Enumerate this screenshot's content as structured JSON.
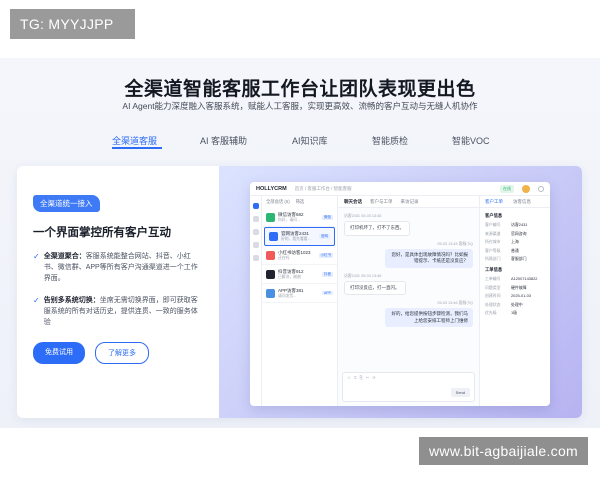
{
  "overlay": {
    "tag_label": "TG: MYYJJPP",
    "watermark": "www.bit-agbaijiale.com"
  },
  "hero": {
    "title": "全渠道智能客服工作台让团队表现更出色",
    "subtitle": "AI Agent能力深度融入客服系统，赋能人工客服，实现更高效、流畅的客户互动与无缝人机协作"
  },
  "tabs": [
    {
      "label": "全渠道客服",
      "active": true
    },
    {
      "label": "AI 客服辅助",
      "active": false
    },
    {
      "label": "AI知识库",
      "active": false
    },
    {
      "label": "智能质检",
      "active": false
    },
    {
      "label": "智能VOC",
      "active": false
    }
  ],
  "feature": {
    "badge": "全渠道统一接入",
    "title": "一个界面掌控所有客户互动",
    "bullets": [
      {
        "head": "全渠道聚合：",
        "text": "客服系统能整合网站、抖音、小红书、微信群、APP等所有客户沟通渠道进一个工作界面。"
      },
      {
        "head": "告别多系统切换：",
        "text": "坐席无需切换界面，即可获取客服系统的所有对话历史，提供连贯、一致的服务体验"
      }
    ],
    "primary_button": "免费试用",
    "secondary_button": "了解更多"
  },
  "mock_app": {
    "brand": "HOLLYCRM",
    "breadcrumb": "首页 / 客服工作台 / 智能客服",
    "status": "在线",
    "conv_header": [
      "全部会话 (6)",
      "筛选"
    ],
    "conversations": [
      {
        "name": "微信访客682",
        "sub": "你好，请问...",
        "tag": "微信",
        "color": "#2bb673"
      },
      {
        "name": "官网访客2431",
        "sub": "好的，我先看看...",
        "tag": "官网",
        "color": "#2c6cf6",
        "selected": true
      },
      {
        "name": "小红书访客1023",
        "sub": "还在吗",
        "tag": "小红书",
        "color": "#f25a5a"
      },
      {
        "name": "抖音访客912",
        "sub": "已解决，谢谢",
        "tag": "抖音",
        "color": "#1f2430"
      },
      {
        "name": "APP访客381",
        "sub": "请问发货...",
        "tag": "APP",
        "color": "#4a90e2"
      }
    ],
    "chat_tabs": [
      "聊天会话",
      "客户与工单",
      "来访记录"
    ],
    "messages": [
      {
        "side": "left",
        "meta": "访客2431  05-03 13:45",
        "text": "打印机坏了，打不了东西。"
      },
      {
        "side": "right",
        "meta": "05-03 13:45  客服小Q",
        "text": "您好，是具体出现故障情况吗？比如报错提示、卡纸还是没反应？"
      },
      {
        "side": "left",
        "meta": "访客2431  05-03 13:46",
        "text": "打印没反应，打一直闪。"
      },
      {
        "side": "right",
        "meta": "05-03 13:46  客服小Q",
        "text": "好的，给您提供按钮步骤检测，我们马上给您安排工程师上门维修"
      }
    ],
    "composer_tools": "☺ ⌗ ⎘ ✂ ⟳",
    "send_label": "Send",
    "info_tabs": [
      "客户工单",
      "访客信息"
    ],
    "info_sections": [
      {
        "title": "客户信息",
        "rows": [
          {
            "k": "客户编号",
            "v": "访客2431"
          },
          {
            "k": "来源渠道",
            "v": "官网咨询"
          },
          {
            "k": "所在城市",
            "v": "上海"
          },
          {
            "k": "客户等级",
            "v": "普通"
          },
          {
            "k": "所属部门",
            "v": "客服部门"
          }
        ]
      },
      {
        "title": "工单信息",
        "rows": [
          {
            "k": "工单编号",
            "v": "A12007143822"
          },
          {
            "k": "问题类型",
            "v": "硬件故障"
          },
          {
            "k": "创建时间",
            "v": "2025-01-03"
          },
          {
            "k": "处理状态",
            "v": "处理中"
          },
          {
            "k": "优先级",
            "v": "1级"
          }
        ]
      }
    ]
  }
}
